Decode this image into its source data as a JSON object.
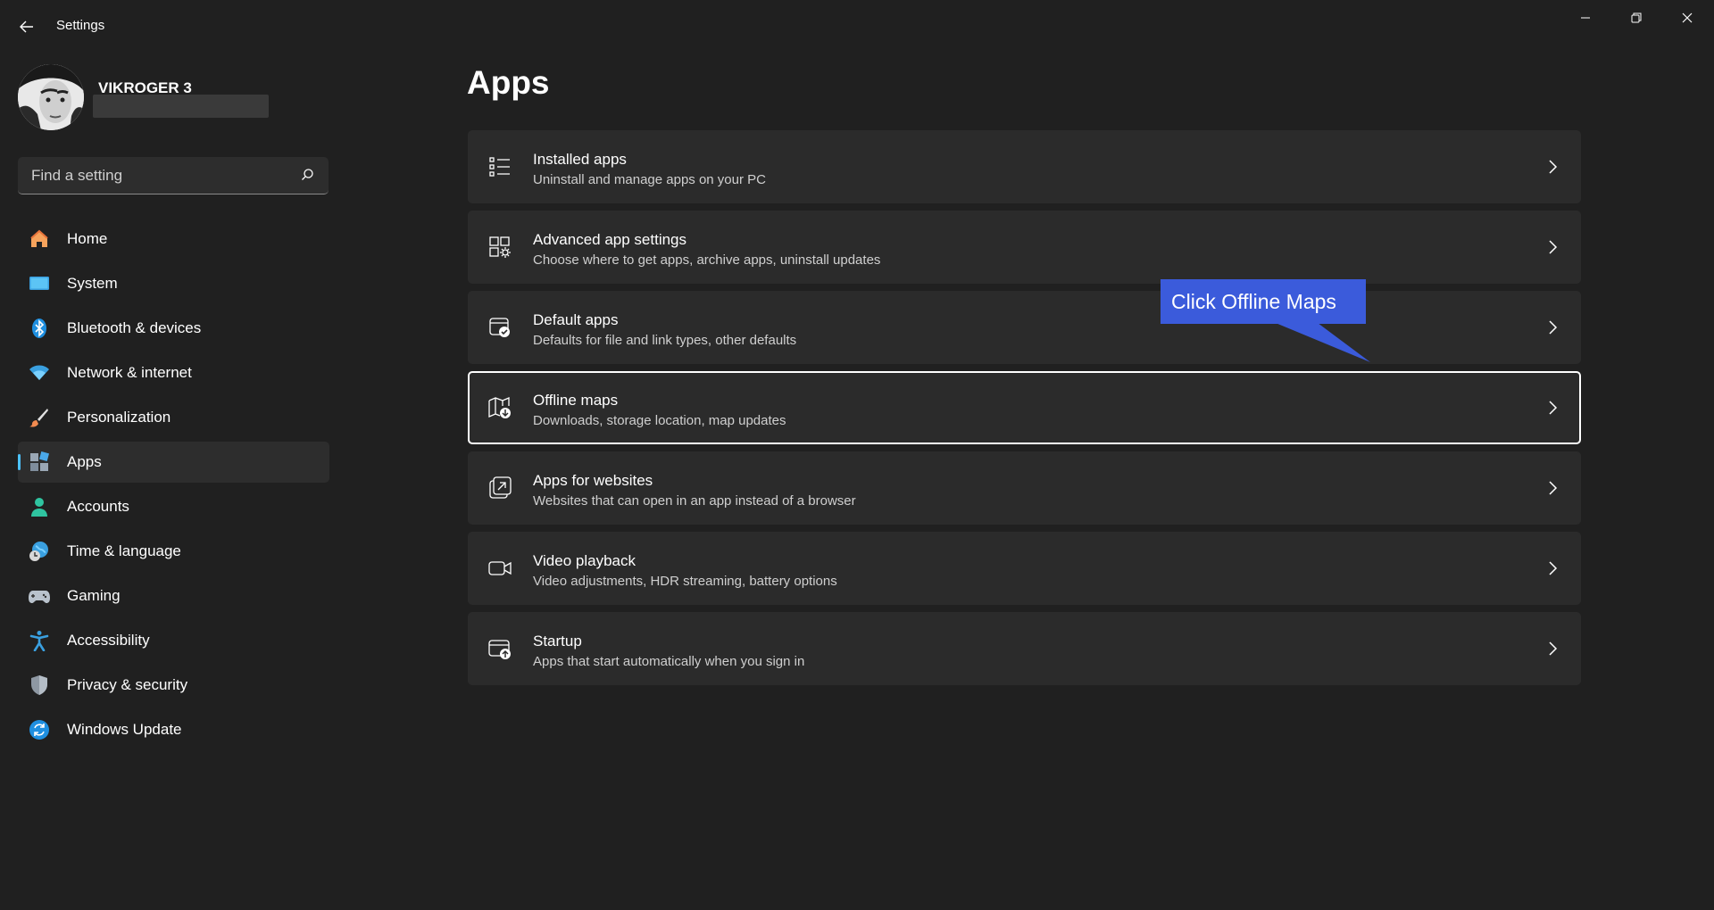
{
  "window": {
    "title": "Settings"
  },
  "profile": {
    "name": "VIKROGER 3"
  },
  "search": {
    "placeholder": "Find a setting"
  },
  "sidebar": {
    "items": [
      {
        "label": "Home",
        "icon": "home-icon"
      },
      {
        "label": "System",
        "icon": "system-icon"
      },
      {
        "label": "Bluetooth & devices",
        "icon": "bluetooth-icon"
      },
      {
        "label": "Network & internet",
        "icon": "wifi-icon"
      },
      {
        "label": "Personalization",
        "icon": "brush-icon"
      },
      {
        "label": "Apps",
        "icon": "apps-icon",
        "selected": true
      },
      {
        "label": "Accounts",
        "icon": "account-icon"
      },
      {
        "label": "Time & language",
        "icon": "globe-clock-icon"
      },
      {
        "label": "Gaming",
        "icon": "gamepad-icon"
      },
      {
        "label": "Accessibility",
        "icon": "accessibility-icon"
      },
      {
        "label": "Privacy & security",
        "icon": "shield-icon"
      },
      {
        "label": "Windows Update",
        "icon": "update-icon"
      }
    ]
  },
  "main": {
    "title": "Apps",
    "cards": [
      {
        "title": "Installed apps",
        "subtitle": "Uninstall and manage apps on your PC",
        "icon": "list-icon"
      },
      {
        "title": "Advanced app settings",
        "subtitle": "Choose where to get apps, archive apps, uninstall updates",
        "icon": "advanced-apps-icon"
      },
      {
        "title": "Default apps",
        "subtitle": "Defaults for file and link types, other defaults",
        "icon": "default-apps-icon"
      },
      {
        "title": "Offline maps",
        "subtitle": "Downloads, storage location, map updates",
        "icon": "map-download-icon",
        "highlighted": true
      },
      {
        "title": "Apps for websites",
        "subtitle": "Websites that can open in an app instead of a browser",
        "icon": "open-link-icon"
      },
      {
        "title": "Video playback",
        "subtitle": "Video adjustments, HDR streaming, battery options",
        "icon": "video-camera-icon"
      },
      {
        "title": "Startup",
        "subtitle": "Apps that start automatically when you sign in",
        "icon": "startup-icon"
      }
    ]
  },
  "annotation": {
    "text": "Click Offline Maps",
    "color": "#3b5bdb"
  },
  "colors": {
    "background": "#202020",
    "card": "#2b2b2b",
    "accent": "#4cc2ff"
  }
}
